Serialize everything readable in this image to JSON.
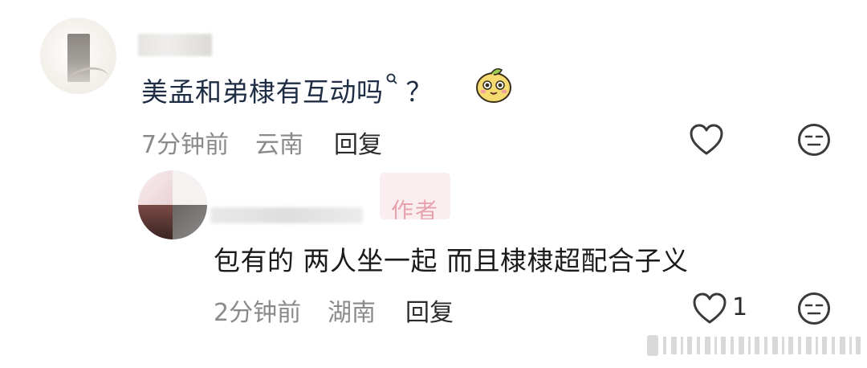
{
  "comments": [
    {
      "text": "美孟和弟棣有互动吗",
      "trailing": "？",
      "time": "7分钟前",
      "location": "云南",
      "reply_label": "回复",
      "like_count": ""
    },
    {
      "badge": "作者",
      "text": "包有的 两人坐一起 而且棣棣超配合子义",
      "time": "2分钟前",
      "location": "湖南",
      "reply_label": "回复",
      "like_count": "1"
    }
  ],
  "icons": {
    "like": "heart-outline-icon",
    "dislike": "neutral-face-icon",
    "search": "search-small-icon",
    "emoji": "mango-sticker-emoji",
    "watermark": "barcode-watermark"
  },
  "colors": {
    "comment_text": "#1f2d44",
    "meta_text": "#8a8a8a",
    "icon_stroke": "#3a3a3a",
    "badge_bg": "#fbeef0",
    "badge_text": "#e7a3ad"
  }
}
